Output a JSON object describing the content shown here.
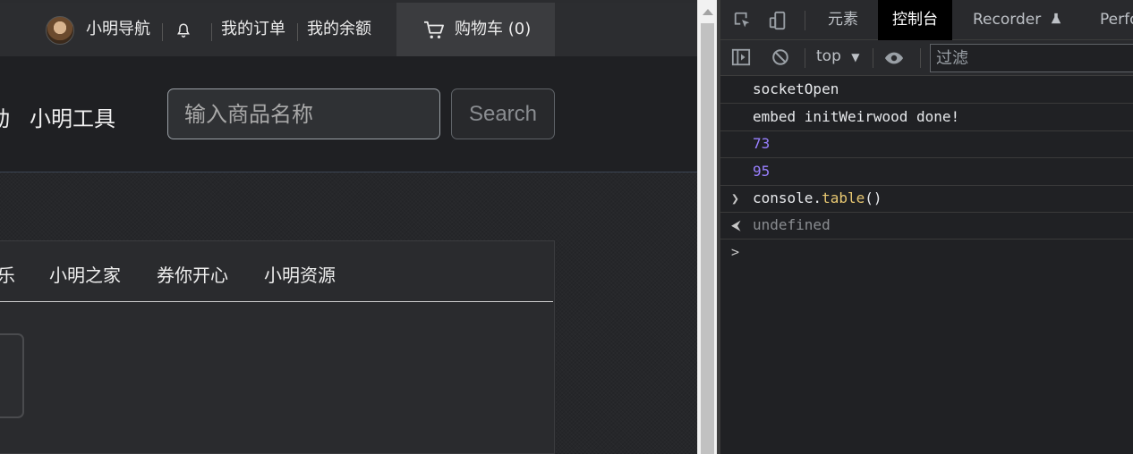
{
  "webpage": {
    "topbar": {
      "nav_label": "小明导航",
      "orders_label": "我的订单",
      "balance_label": "我的余额",
      "cart_label": "购物车 (0)"
    },
    "navbar": {
      "partial_text": "动",
      "brand": "小明工具",
      "search_placeholder": "输入商品名称",
      "search_button": "Search"
    },
    "panel_nav": [
      {
        "label": "乐"
      },
      {
        "label": "小明之家"
      },
      {
        "label": "券你开心"
      },
      {
        "label": "小明资源"
      }
    ]
  },
  "devtools": {
    "tabs": [
      {
        "label": "元素"
      },
      {
        "label": "控制台",
        "active": true
      },
      {
        "label": "Recorder"
      },
      {
        "label": "Perfo"
      }
    ],
    "toolbar": {
      "context": "top",
      "filter_placeholder": "过滤"
    },
    "console": {
      "logs": [
        {
          "text": "socketOpen"
        },
        {
          "text": "embed initWeirwood done!"
        },
        {
          "text": "73"
        },
        {
          "text": "95"
        }
      ],
      "input_object": "console.",
      "input_method": "table",
      "input_args": "()",
      "result": "undefined",
      "prompt_symbol": ">"
    }
  },
  "colors": {
    "number": "#9980ff",
    "prompt": "#4d90fe",
    "active_tab_bg": "#000000"
  }
}
